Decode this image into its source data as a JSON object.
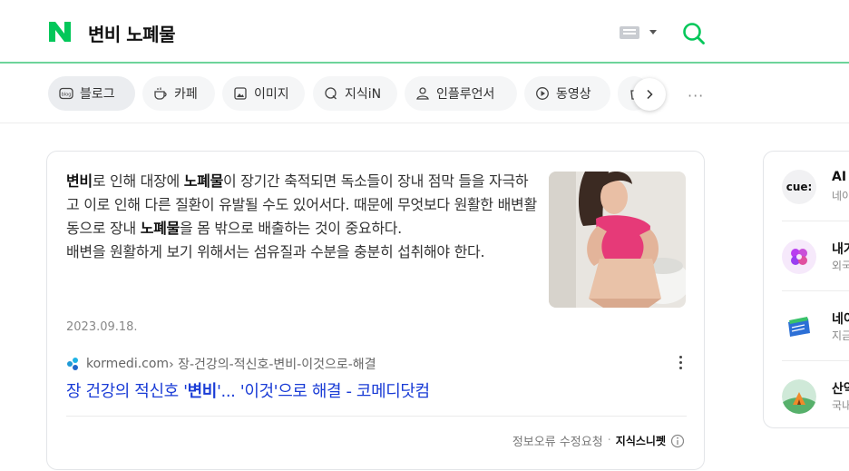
{
  "header": {
    "query": "변비 노폐물",
    "keyboard_icon": "keyboard-icon",
    "search_icon": "search-icon",
    "brand_color": "#03c75a"
  },
  "tabs": [
    {
      "label": "블로그",
      "icon": "blog-icon"
    },
    {
      "label": "카페",
      "icon": "cafe-icon"
    },
    {
      "label": "이미지",
      "icon": "image-icon"
    },
    {
      "label": "지식iN",
      "icon": "kin-icon"
    },
    {
      "label": "인플루언서",
      "icon": "person-icon"
    },
    {
      "label": "동영상",
      "icon": "play-icon"
    },
    {
      "label": "",
      "icon": "shopping-icon"
    }
  ],
  "tabs_more": "···",
  "result": {
    "snippet": [
      {
        "text": "변비",
        "bold": true
      },
      {
        "text": "로 인해 대장에 ",
        "bold": false
      },
      {
        "text": "노폐물",
        "bold": true
      },
      {
        "text": "이 장기간 축적되면 독소들이 장내 점막 들을 자극하고 이로 인해 다른 질환이 유발될 수도 있어서다. 때문에 무엇보다 원활한 배변활동으로 장내 ",
        "bold": false
      },
      {
        "text": "노폐물",
        "bold": true
      },
      {
        "text": "을 몸 밖으로 배출하는 것이 중요하다.",
        "bold": false
      },
      {
        "text": "\n배변을 원활하게 보기 위해서는 섬유질과 수분을 충분히 섭취해야 한다.",
        "bold": false
      }
    ],
    "date": "2023.09.18.",
    "source_site": "kormedi.com",
    "source_path": " › 장-건강의-적신호-변비-이것으로-해결",
    "title_parts": [
      {
        "text": "장 건강의 적신호 '",
        "bold": false
      },
      {
        "text": "변비",
        "bold": true
      },
      {
        "text": "'... '이것'으로 해결 - 코메디닷컴",
        "bold": false
      }
    ],
    "report_label": "정보오류 수정요청",
    "separator": "·",
    "snippet_tag": "지식스니펫"
  },
  "side_panel": [
    {
      "title": "AI",
      "sub": "네이",
      "badge": "cue:",
      "badge_color": "#f1f1f3"
    },
    {
      "title": "내가",
      "sub": "외국",
      "badge": "",
      "badge_color": "#f6e9fb"
    },
    {
      "title": "네이",
      "sub": "지금",
      "badge": "",
      "badge_color": "#ffffff"
    },
    {
      "title": "산약",
      "sub": "국내",
      "badge": "",
      "badge_color": "#dff1e6"
    }
  ]
}
